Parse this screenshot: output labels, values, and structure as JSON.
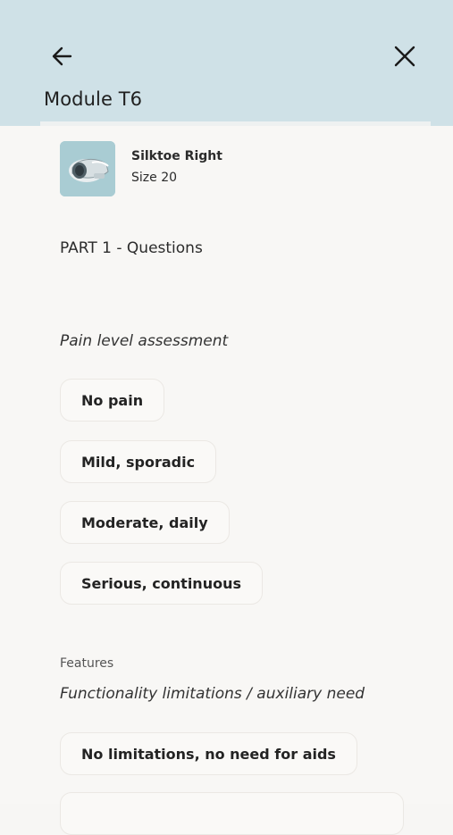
{
  "header": {
    "title": "Module T6",
    "back_icon": "arrow-left-icon",
    "close_icon": "close-icon",
    "background": "#cfe1e7"
  },
  "product": {
    "name": "Silktoe Right",
    "size": "Size 20",
    "thumbnail_icon": "prosthetic-toe-image"
  },
  "part_title": "PART 1 - Questions",
  "pain_section": {
    "question": "Pain level assessment",
    "options": [
      "No pain",
      "Mild, sporadic",
      "Moderate, daily",
      "Serious, continuous"
    ]
  },
  "features_section": {
    "label": "Features",
    "question": "Functionality limitations / auxiliary need",
    "options": [
      "No limitations, no need for aids"
    ]
  }
}
